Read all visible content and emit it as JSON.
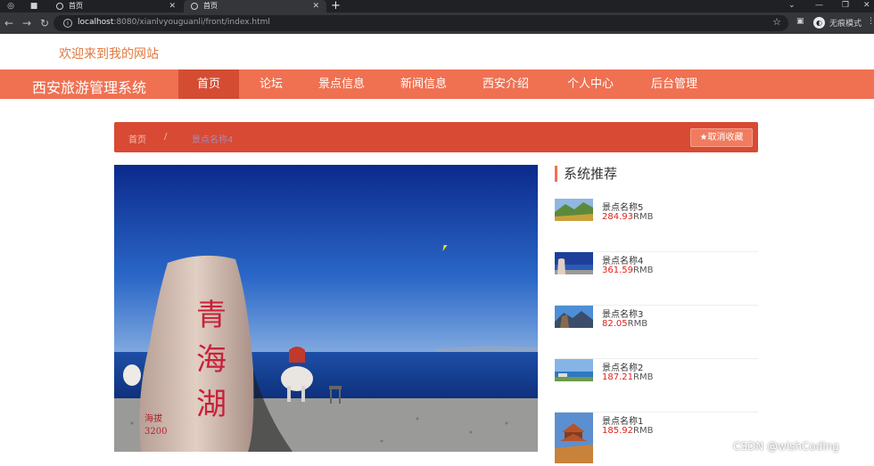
{
  "browser": {
    "tabs": [
      {
        "title": "首页",
        "close": "✕"
      },
      {
        "title": "首页",
        "close": "✕"
      }
    ],
    "new_tab": "+",
    "url_host": "localhost",
    "url_rest": ":8080/xianlvyouguanli/front/index.html",
    "incognito_label": "无痕模式",
    "icons": [
      "back-icon",
      "forward-icon",
      "reload-icon",
      "info-icon",
      "star-icon",
      "sidepanel-icon",
      "incognito-icon",
      "menu-icon"
    ]
  },
  "site": {
    "welcome": "欢迎来到我的网站",
    "title": "西安旅游管理系统",
    "nav": [
      {
        "label": "首页",
        "active": true
      },
      {
        "label": "论坛"
      },
      {
        "label": "景点信息"
      },
      {
        "label": "新闻信息"
      },
      {
        "label": "西安介绍"
      },
      {
        "label": "个人中心"
      },
      {
        "label": "后台管理"
      }
    ]
  },
  "breadcrumb": {
    "home": "首页",
    "separator": "/",
    "current": "景点名称4"
  },
  "favorite_button": {
    "icon": "★",
    "label": "取消收藏"
  },
  "hero": {
    "stone_text": [
      "青",
      "海",
      "湖"
    ],
    "stone_small": "海拔",
    "stone_num": "3200"
  },
  "recommend": {
    "title": "系统推荐",
    "currency": "RMB",
    "items": [
      {
        "name": "景点名称5",
        "price": "284.93"
      },
      {
        "name": "景点名称4",
        "price": "361.59"
      },
      {
        "name": "景点名称3",
        "price": "82.05"
      },
      {
        "name": "景点名称2",
        "price": "187.21"
      },
      {
        "name": "景点名称1",
        "price": "185.92"
      }
    ]
  },
  "colors": {
    "nav_bg": "#ef7152",
    "nav_active": "#d44d33",
    "breadcrumb_bg": "#d84a33",
    "price": "#e0201a",
    "welcome": "#e0793f"
  },
  "watermark": "CSDN @wishCoding"
}
